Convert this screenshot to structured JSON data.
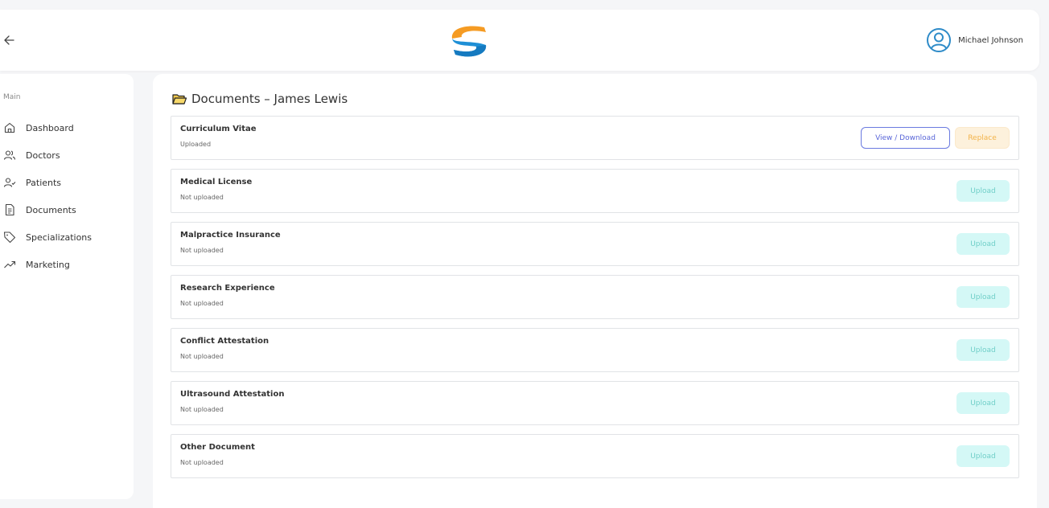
{
  "header": {
    "back_icon": "arrow-left-icon",
    "logo_icon": "s-logo-icon",
    "user_icon": "user-circle-icon",
    "user_name": "Michael Johnson"
  },
  "sidebar": {
    "section_label": "Main",
    "items": [
      {
        "label": "Dashboard",
        "icon": "home-icon"
      },
      {
        "label": "Doctors",
        "icon": "users-icon"
      },
      {
        "label": "Patients",
        "icon": "user-check-icon"
      },
      {
        "label": "Documents",
        "icon": "file-text-icon"
      },
      {
        "label": "Specializations",
        "icon": "tag-icon"
      },
      {
        "label": "Marketing",
        "icon": "trending-up-icon"
      }
    ]
  },
  "main": {
    "title_icon": "folder-icon",
    "title": "Documents – James Lewis",
    "documents": [
      {
        "name": "Curriculum Vitae",
        "status": "Uploaded",
        "view_label": "View / Download",
        "action_label": "Replace"
      },
      {
        "name": "Medical License",
        "status": "Not uploaded",
        "action_label": "Upload"
      },
      {
        "name": "Malpractice Insurance",
        "status": "Not uploaded",
        "action_label": "Upload"
      },
      {
        "name": "Research Experience",
        "status": "Not uploaded",
        "action_label": "Upload"
      },
      {
        "name": "Conflict Attestation",
        "status": "Not uploaded",
        "action_label": "Upload"
      },
      {
        "name": "Ultrasound Attestation",
        "status": "Not uploaded",
        "action_label": "Upload"
      },
      {
        "name": "Other Document",
        "status": "Not uploaded",
        "action_label": "Upload"
      }
    ]
  },
  "colors": {
    "view_border": "#6a7ae0",
    "replace_text": "#f3b34a",
    "upload_bg": "#d4f8f6",
    "upload_text": "#70cfc8",
    "logo_orange": "#f59b23",
    "logo_blue": "#1e8fd6"
  }
}
